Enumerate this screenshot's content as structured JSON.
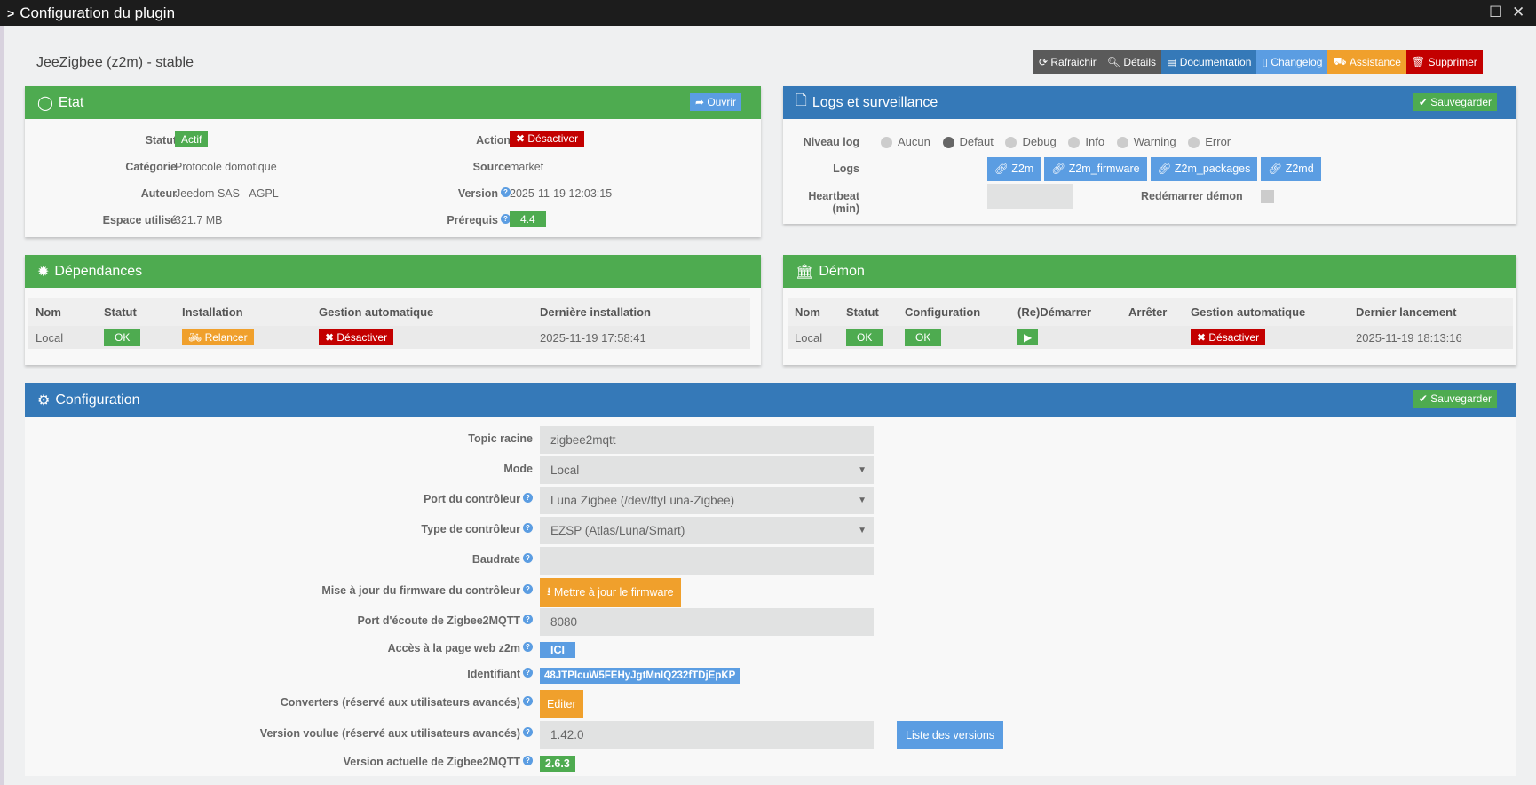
{
  "window": {
    "title": "Configuration du plugin"
  },
  "page_title": "JeeZigbee (z2m) - stable",
  "toolbar": [
    "Rafraichir",
    "Détails",
    "Documentation",
    "Changelog",
    "Assistance",
    "Supprimer"
  ],
  "etat": {
    "title": "Etat",
    "open": "Ouvrir",
    "statut_label": "Statut",
    "statut": "Actif",
    "categorie_label": "Catégorie",
    "categorie": "Protocole domotique",
    "auteur_label": "Auteur",
    "auteur": "Jeedom SAS - AGPL",
    "espace_label": "Espace utilisé",
    "espace": "321.7 MB",
    "action_label": "Action",
    "action": "Désactiver",
    "source_label": "Source",
    "source": "market",
    "version_label": "Version",
    "version": "2025-11-19 12:03:15",
    "prerequis_label": "Prérequis",
    "prerequis": "4.4"
  },
  "logs": {
    "title": "Logs et surveillance",
    "save": "Sauvegarder",
    "niveau_label": "Niveau log",
    "levels": [
      "Aucun",
      "Defaut",
      "Debug",
      "Info",
      "Warning",
      "Error"
    ],
    "selected_level": "Defaut",
    "logs_label": "Logs",
    "log_buttons": [
      "Z2m",
      "Z2m_firmware",
      "Z2m_packages",
      "Z2md"
    ],
    "heartbeat_label": "Heartbeat (min)",
    "heartbeat": "",
    "restart_label": "Redémarrer démon",
    "restart_checked": false
  },
  "deps": {
    "title": "Dépendances",
    "headers": [
      "Nom",
      "Statut",
      "Installation",
      "Gestion automatique",
      "Dernière installation"
    ],
    "row": {
      "nom": "Local",
      "statut": "OK",
      "installation": "Relancer",
      "gestion": "Désactiver",
      "derniere": "2025-11-19 17:58:41"
    }
  },
  "demon": {
    "title": "Démon",
    "headers": [
      "Nom",
      "Statut",
      "Configuration",
      "(Re)Démarrer",
      "Arrêter",
      "Gestion automatique",
      "Dernier lancement"
    ],
    "row": {
      "nom": "Local",
      "statut": "OK",
      "configuration": "OK",
      "gestion": "Désactiver",
      "dernier": "2025-11-19 18:13:16"
    }
  },
  "config": {
    "title": "Configuration",
    "save": "Sauvegarder",
    "topic_label": "Topic racine",
    "topic": "zigbee2mqtt",
    "mode_label": "Mode",
    "mode": "Local",
    "port_label": "Port du contrôleur",
    "port": "Luna Zigbee (/dev/ttyLuna-Zigbee)",
    "type_label": "Type de contrôleur",
    "type": "EZSP (Atlas/Luna/Smart)",
    "baud_label": "Baudrate",
    "baud": "",
    "fw_label": "Mise à jour du firmware du contrôleur",
    "fw_btn": "Mettre à jour le firmware",
    "listen_label": "Port d'écoute de Zigbee2MQTT",
    "listen": "8080",
    "web_label": "Accès à la page web z2m",
    "web_btn": "ICI",
    "id_label": "Identifiant",
    "id": "48JTPIcuW5FEHyJgtMnIQ232fTDjEpKP",
    "conv_label": "Converters (réservé aux utilisateurs avancés)",
    "conv_btn": "Editer",
    "wanted_label": "Version voulue (réservé aux utilisateurs avancés)",
    "wanted": "1.42.0",
    "versions_btn": "Liste des versions",
    "current_label": "Version actuelle de Zigbee2MQTT",
    "current": "2.6.3"
  }
}
